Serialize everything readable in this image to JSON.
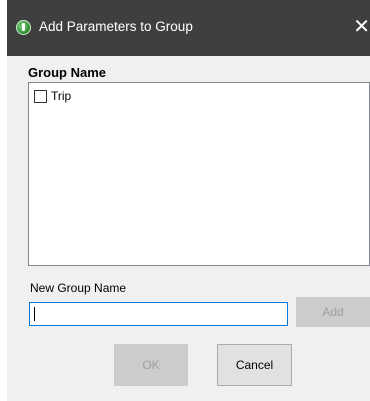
{
  "window": {
    "title": "Add Parameters to Group",
    "close_symbol": "✕",
    "icon": "app-logo-icon"
  },
  "group_name": {
    "label": "Group Name",
    "items": [
      {
        "label": "Trip",
        "checked": false
      }
    ]
  },
  "new_group": {
    "label": "New Group Name",
    "value": ""
  },
  "buttons": {
    "add": "Add",
    "ok": "OK",
    "cancel": "Cancel"
  }
}
